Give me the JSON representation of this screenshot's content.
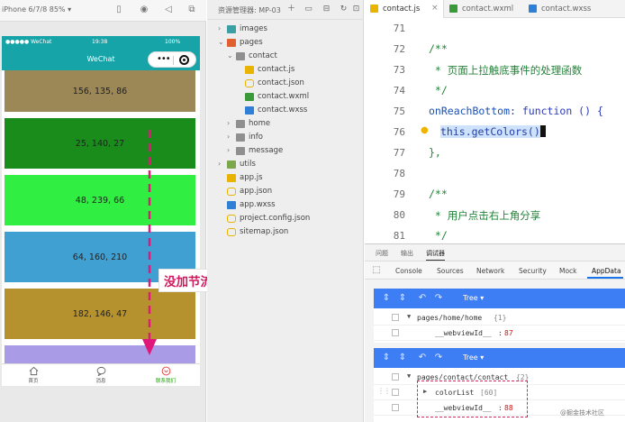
{
  "simulator": {
    "device_label": "iPhone 6/7/8 85% ▾",
    "statusbar": {
      "signal": "●●●●● WeChat",
      "time": "19:38",
      "battery": "100%"
    },
    "nav_title": "WeChat",
    "capsule_more": "•••",
    "color_blocks": [
      {
        "label": "156, 135, 86",
        "color": "#9c8756"
      },
      {
        "label": "25, 140, 27",
        "color": "#198c1b"
      },
      {
        "label": "48, 239, 66",
        "color": "#30ef42"
      },
      {
        "label": "64, 160, 210",
        "color": "#40a0d2"
      },
      {
        "label": "182, 146, 47",
        "color": "#b6922f"
      },
      {
        "label": "",
        "color": "#a99be6"
      }
    ],
    "tabs": [
      {
        "label": "首页",
        "icon": "home-icon"
      },
      {
        "label": "消息",
        "icon": "message-icon"
      },
      {
        "label": "联系我们",
        "icon": "contact-icon",
        "active": true
      }
    ]
  },
  "annotation_text": "没加节流，一触底一直在加载数据",
  "explorer": {
    "title": "资源管理器: MP-03",
    "tree": [
      {
        "label": "images",
        "type": "folder-img",
        "caret": "›",
        "indent": 0
      },
      {
        "label": "pages",
        "type": "folder-red",
        "caret": "⌄",
        "indent": 0
      },
      {
        "label": "contact",
        "type": "folder",
        "caret": "⌄",
        "indent": 1
      },
      {
        "label": "contact.js",
        "type": "js",
        "caret": "",
        "indent": 2
      },
      {
        "label": "contact.json",
        "type": "json",
        "caret": "",
        "indent": 2
      },
      {
        "label": "contact.wxml",
        "type": "wxml",
        "caret": "",
        "indent": 2
      },
      {
        "label": "contact.wxss",
        "type": "wxss",
        "caret": "",
        "indent": 2
      },
      {
        "label": "home",
        "type": "folder",
        "caret": "›",
        "indent": 1
      },
      {
        "label": "info",
        "type": "folder",
        "caret": "›",
        "indent": 1
      },
      {
        "label": "message",
        "type": "folder",
        "caret": "›",
        "indent": 1
      },
      {
        "label": "utils",
        "type": "folder-util",
        "caret": "›",
        "indent": 0
      },
      {
        "label": "app.js",
        "type": "js",
        "caret": "",
        "indent": 0
      },
      {
        "label": "app.json",
        "type": "json",
        "caret": "",
        "indent": 0
      },
      {
        "label": "app.wxss",
        "type": "wxss",
        "caret": "",
        "indent": 0
      },
      {
        "label": "project.config.json",
        "type": "json",
        "caret": "",
        "indent": 0
      },
      {
        "label": "sitemap.json",
        "type": "json",
        "caret": "",
        "indent": 0
      }
    ]
  },
  "editor": {
    "tabs": [
      {
        "label": "contact.js",
        "type": "js",
        "active": true
      },
      {
        "label": "contact.wxml",
        "type": "wxml",
        "active": false
      },
      {
        "label": "contact.wxss",
        "type": "wxss",
        "active": false
      }
    ],
    "close_glyph": "×",
    "lines": [
      {
        "n": "71",
        "code": ""
      },
      {
        "n": "72",
        "code": "/**"
      },
      {
        "n": "73",
        "code": " * 页面上拉触底事件的处理函数"
      },
      {
        "n": "74",
        "code": " */"
      },
      {
        "n": "75",
        "key": "onReachBottom",
        "rest": ": function () {"
      },
      {
        "n": "76",
        "this": "this.getColors()"
      },
      {
        "n": "77",
        "code": "},"
      },
      {
        "n": "78",
        "code": ""
      },
      {
        "n": "79",
        "code": "/**"
      },
      {
        "n": "80",
        "code": " * 用户点击右上角分享"
      },
      {
        "n": "81",
        "code": " */"
      }
    ]
  },
  "debug": {
    "top_tabs": [
      "问题",
      "输出",
      "调试器"
    ],
    "tabs": [
      "Console",
      "Sources",
      "Network",
      "Security",
      "Mock",
      "AppData"
    ],
    "tree_label": "Tree ▾",
    "home_panel": {
      "path": "pages/home/home",
      "count": "{1}",
      "key": "__webviewId__",
      "value": "87"
    },
    "contact_panel": {
      "path": "pages/contact/contact",
      "count": "{2}",
      "list_key": "colorList",
      "list_count": "[60]",
      "key": "__webviewId__",
      "value": "88"
    }
  },
  "watermark": "@掘金技术社区"
}
